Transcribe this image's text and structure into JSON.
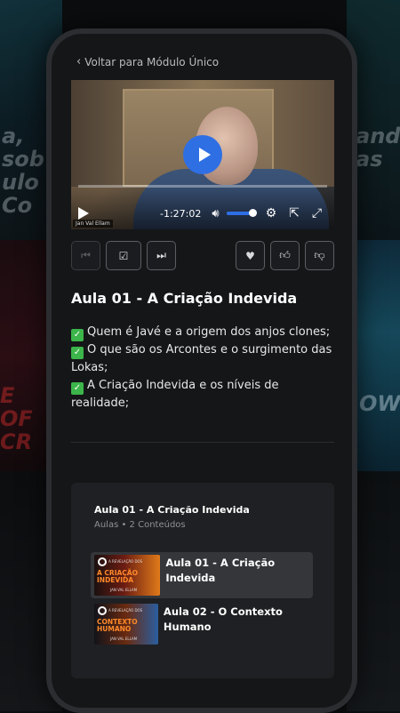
{
  "background": {
    "text_top_left": "a, sob ulo Co",
    "text_top_right": "ando as",
    "text_mid_left": "E OF CR",
    "text_mid_right": "OW"
  },
  "header": {
    "back_label": "Voltar para Módulo Único"
  },
  "player": {
    "time_remaining": "-1:27:02",
    "caption": "Jan Val Ellam",
    "progress": 0.0,
    "volume": 0.8
  },
  "lesson": {
    "title": "Aula 01 - A Criação Indevida",
    "bullets": [
      "Quem é Javé e a origem dos anjos clones;",
      "O que são os Arcontes e o surgimento das Lokas;",
      "A Criação Indevida e os níveis de realidade;"
    ]
  },
  "playlist": {
    "title": "Aula 01 - A Criação Indevida",
    "subtitle": "Aulas • 2 Conteúdos",
    "items": [
      {
        "label": "Aula 01 - A Criação Indevida",
        "thumb_text": "A Criação Indevida",
        "thumb_series": "A REVELAÇÃO DOS",
        "thumb_author": "JAN VAL ELLAM"
      },
      {
        "label": "Aula 02 - O Contexto Humano",
        "thumb_text": "Contexto Humano",
        "thumb_series": "A REVELAÇÃO DOS",
        "thumb_author": "JAN VAL ELLAM"
      }
    ]
  },
  "colors": {
    "accent": "#2f6fe4",
    "check": "#3cb54a",
    "screen_bg": "#151618"
  }
}
